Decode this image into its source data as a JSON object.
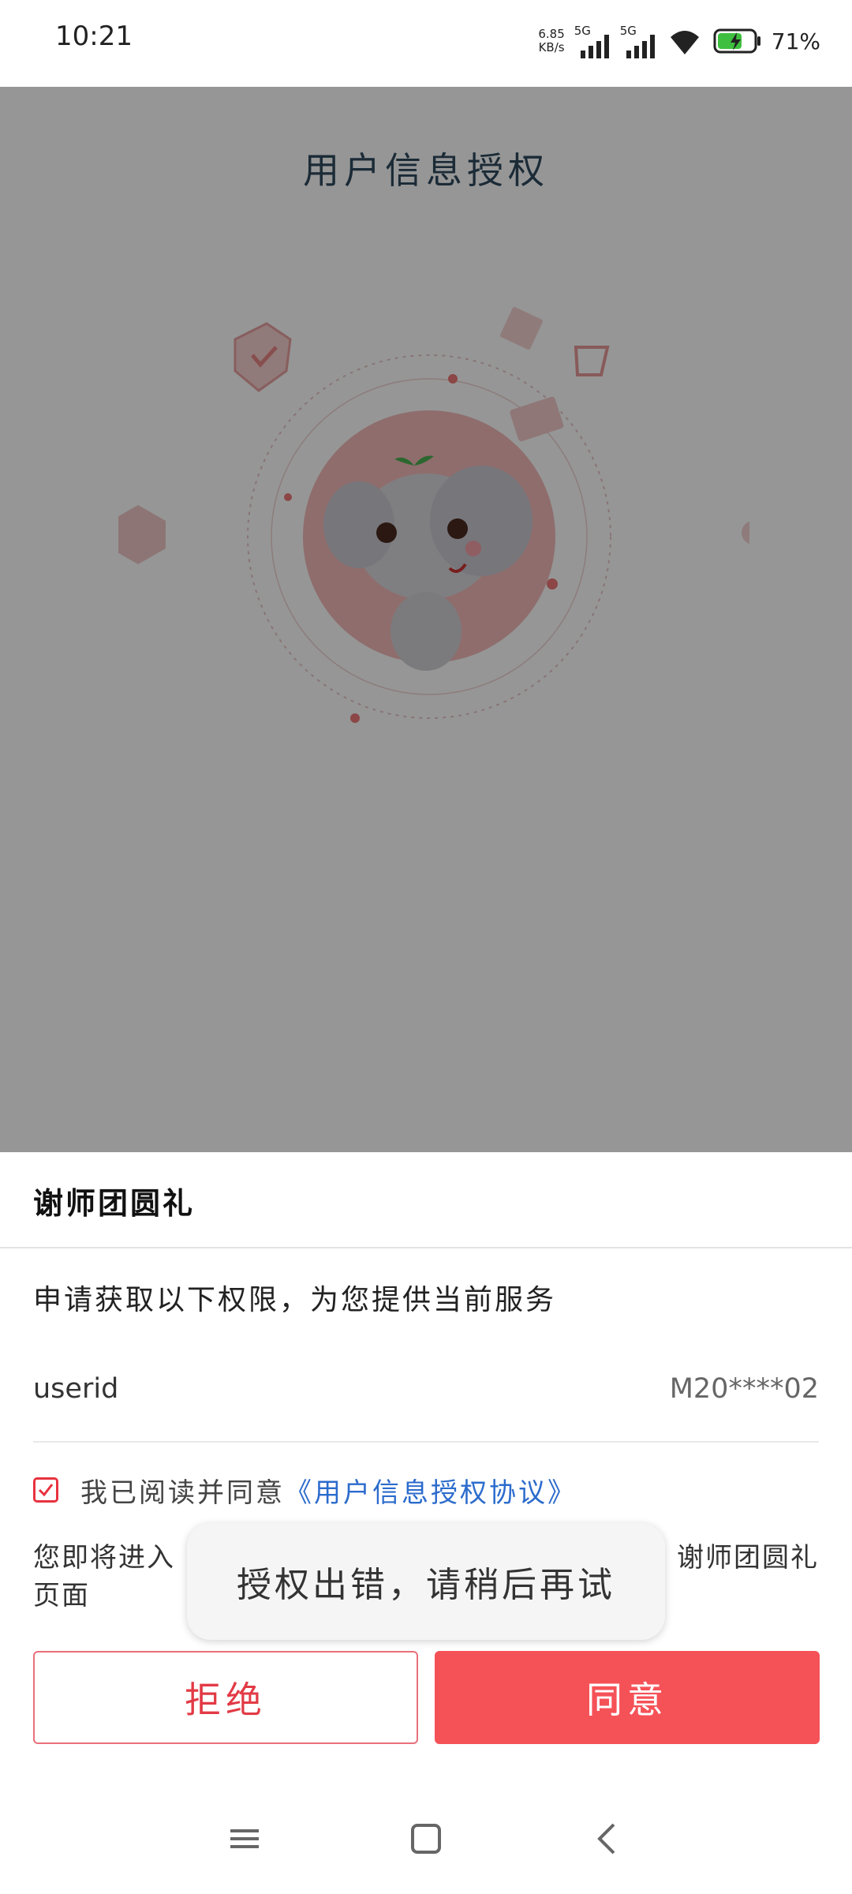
{
  "status_bar": {
    "time": "10:21",
    "net_speed_value": "6.85",
    "net_speed_unit": "KB/s",
    "signal1_label": "5G",
    "signal2_label": "5G",
    "battery_percent": "71%"
  },
  "page": {
    "title": "用户信息授权"
  },
  "sheet": {
    "app_name": "谢师团圆礼",
    "description": "申请获取以下权限，为您提供当前服务",
    "permission_key": "userid",
    "permission_value": "M20****02",
    "agree_prefix": "我已阅读并同意",
    "agree_link": "《用户信息授权协议》",
    "agree_checked": true,
    "notice_part1": "您即将进入",
    "notice_part2": "谢师团圆礼",
    "notice_part3": "页面",
    "reject_label": "拒绝",
    "agree_label": "同意"
  },
  "toast": {
    "message": "授权出错，请稍后再试"
  },
  "nav": {
    "icons": [
      "menu-icon",
      "home-icon",
      "back-icon"
    ]
  },
  "colors": {
    "accent": "#f55258",
    "link": "#2b6bcc",
    "title": "#2f4a5e"
  }
}
